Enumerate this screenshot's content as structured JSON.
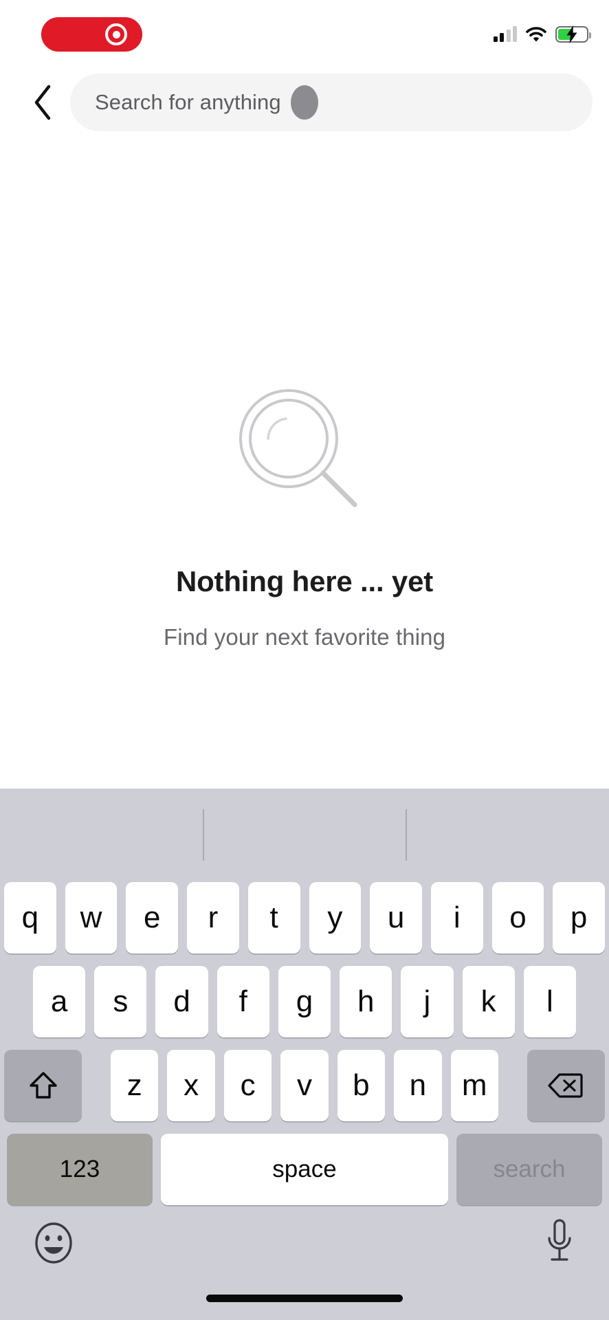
{
  "status_bar": {
    "brand_logo": "target-bullseye-logo",
    "brand_color": "#e01a27",
    "signal_icon": "cellular-signal-icon",
    "signal_bars_filled": 2,
    "signal_bars_total": 4,
    "wifi_icon": "wifi-icon",
    "battery_icon": "battery-charging-icon",
    "battery_level_percent": 55,
    "battery_fill_color": "#2fd144",
    "charging": true
  },
  "header": {
    "back_icon": "chevron-left-icon",
    "search": {
      "placeholder": "Search for anything",
      "value": "",
      "touch_indicator": "touch-point-indicator"
    }
  },
  "empty_state": {
    "icon": "magnifying-glass-icon",
    "icon_color": "#c9c9cd",
    "title": "Nothing here ... yet",
    "subtitle": "Find your next favorite thing"
  },
  "keyboard": {
    "background_color": "#cdced6",
    "predictive_bar": {
      "suggestions": []
    },
    "row1": [
      "q",
      "w",
      "e",
      "r",
      "t",
      "y",
      "u",
      "i",
      "o",
      "p"
    ],
    "row2": [
      "a",
      "s",
      "d",
      "f",
      "g",
      "h",
      "j",
      "k",
      "l"
    ],
    "row3": [
      "z",
      "x",
      "c",
      "v",
      "b",
      "n",
      "m"
    ],
    "shift": {
      "label": "",
      "icon": "shift-arrow-icon"
    },
    "backspace": {
      "label": "",
      "icon": "backspace-delete-icon"
    },
    "numbers_key": "123",
    "space_key": "space",
    "return_key": "search",
    "emoji_icon": "emoji-smiley-icon",
    "dictation_icon": "microphone-icon",
    "home_indicator": "home-indicator-bar"
  }
}
